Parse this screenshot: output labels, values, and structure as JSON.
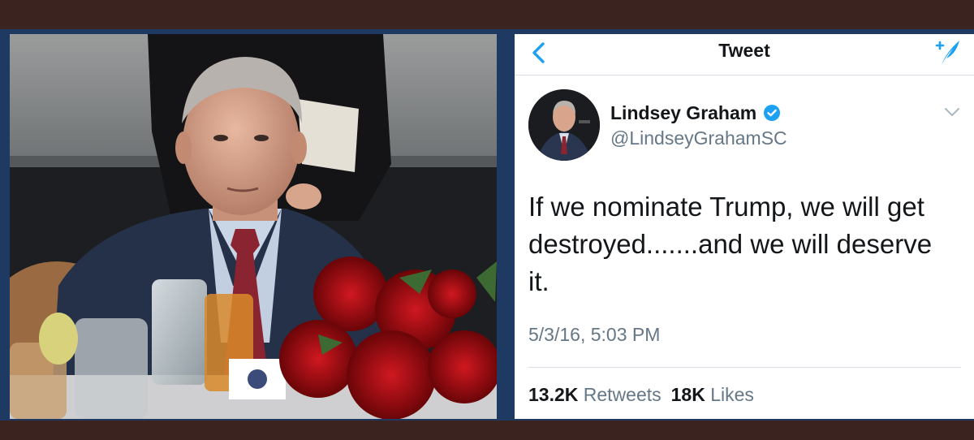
{
  "nav": {
    "title": "Tweet",
    "back_icon": "chevron-left-icon",
    "compose_icon": "compose-feather-icon",
    "accent": "#1da1f2"
  },
  "author": {
    "name": "Lindsey Graham",
    "handle": "@LindseyGrahamSC",
    "verified_icon": "verified-badge-icon"
  },
  "tweet": {
    "text": "If we nominate Trump, we will get destroyed.......and we will deserve it.",
    "timestamp": "5/3/16, 5:03 PM"
  },
  "stats": {
    "retweets_count": "13.2K",
    "retweets_label": "Retweets",
    "likes_count": "18K",
    "likes_label": "Likes"
  },
  "colors": {
    "background": "#3b2420",
    "frame": "#1e3a63",
    "text_primary": "#14171a",
    "text_secondary": "#657786",
    "verified": "#1da1f2"
  }
}
